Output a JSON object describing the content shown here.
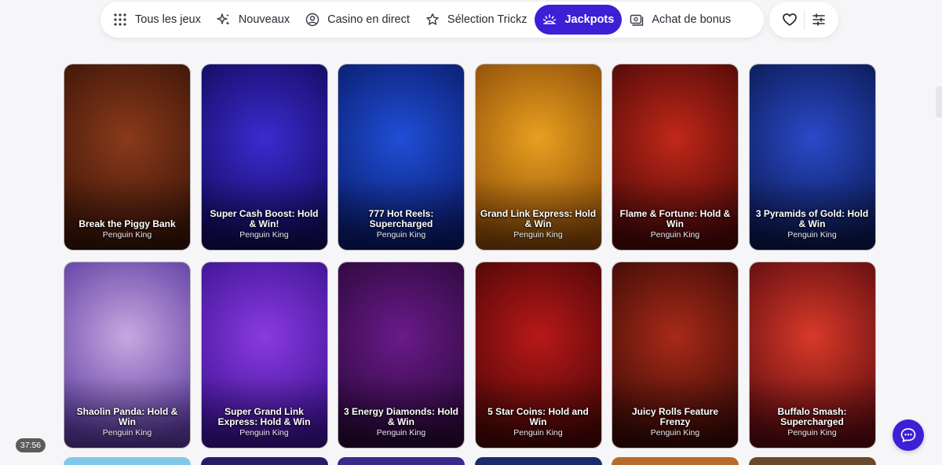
{
  "nav": {
    "items": [
      {
        "label": "Tous les jeux",
        "icon": "grid-icon",
        "active": false
      },
      {
        "label": "Nouveaux",
        "icon": "sparkle-icon",
        "active": false
      },
      {
        "label": "Casino en direct",
        "icon": "user-circle-icon",
        "active": false
      },
      {
        "label": "Sélection Trickz",
        "icon": "star-icon",
        "active": false
      },
      {
        "label": "Jackpots",
        "icon": "jackpot-icon",
        "active": true
      },
      {
        "label": "Achat de bonus",
        "icon": "bonus-buy-icon",
        "active": false
      }
    ],
    "accent": "#3d1fd6"
  },
  "actions": {
    "favorites_icon": "heart-icon",
    "filters_icon": "sliders-icon"
  },
  "games": [
    {
      "title": "Break the Piggy Bank",
      "provider": "Penguin King",
      "colors": [
        "#8a3a1a",
        "#3a1408"
      ]
    },
    {
      "title": "Super Cash Boost: Hold & Win!",
      "provider": "Penguin King",
      "colors": [
        "#3b2bd0",
        "#110a5a"
      ]
    },
    {
      "title": "777 Hot Reels: Supercharged",
      "provider": "Penguin King",
      "colors": [
        "#1f4fd6",
        "#0a1a6a"
      ]
    },
    {
      "title": "Grand Link Express: Hold & Win",
      "provider": "Penguin King",
      "colors": [
        "#e8a020",
        "#8a4a08"
      ]
    },
    {
      "title": "Flame & Fortune: Hold & Win",
      "provider": "Penguin King",
      "colors": [
        "#c02818",
        "#4a0808"
      ]
    },
    {
      "title": "3 Pyramids of Gold: Hold & Win",
      "provider": "Penguin King",
      "colors": [
        "#2a4ac8",
        "#0a1850"
      ]
    },
    {
      "title": "Shaolin Panda: Hold & Win",
      "provider": "Penguin King",
      "colors": [
        "#c8a8e0",
        "#5a3aa0"
      ]
    },
    {
      "title": "Super Grand Link Express: Hold & Win",
      "provider": "Penguin King",
      "colors": [
        "#8a3ae0",
        "#3a1290"
      ]
    },
    {
      "title": "3 Energy Diamonds: Hold & Win",
      "provider": "Penguin King",
      "colors": [
        "#6a1a8a",
        "#2a0838"
      ]
    },
    {
      "title": "5 Star Coins: Hold and Win",
      "provider": "Penguin King",
      "colors": [
        "#b81818",
        "#4a0606"
      ]
    },
    {
      "title": "Juicy Rolls Feature Frenzy",
      "provider": "Penguin King",
      "colors": [
        "#a82a18",
        "#3a0a06"
      ]
    },
    {
      "title": "Buffalo Smash: Supercharged",
      "provider": "Penguin King",
      "colors": [
        "#d83a28",
        "#5a0a10"
      ]
    }
  ],
  "timer": "37:56",
  "chat_icon": "chat-bubble-icon"
}
